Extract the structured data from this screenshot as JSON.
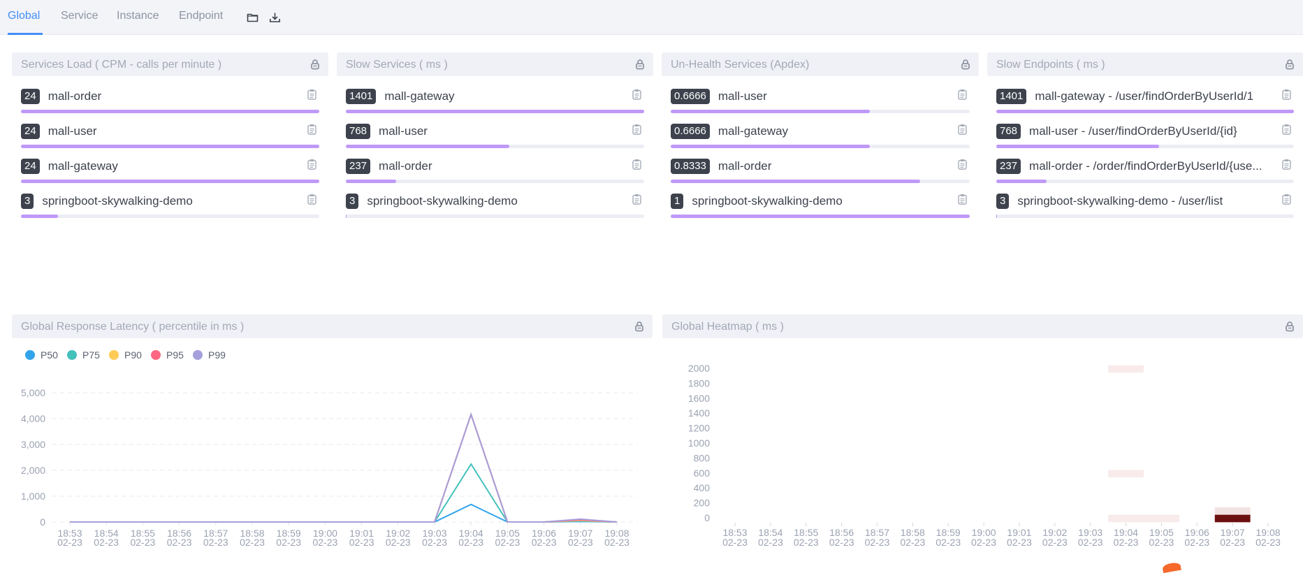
{
  "tabs": [
    {
      "label": "Global",
      "active": true
    },
    {
      "label": "Service",
      "active": false
    },
    {
      "label": "Instance",
      "active": false
    },
    {
      "label": "Endpoint",
      "active": false
    }
  ],
  "toolbar": {
    "icons": [
      "folder-icon",
      "download-icon"
    ]
  },
  "colors": {
    "accent": "#448ef7",
    "bar_fill": "#bf99f8",
    "bar_track": "#ecedf4",
    "badge": "#3d424d"
  },
  "panels": [
    {
      "title": "Services Load ( CPM - calls per minute )",
      "items": [
        {
          "value": "24",
          "label": "mall-order",
          "ratio": 1
        },
        {
          "value": "24",
          "label": "mall-user",
          "ratio": 1
        },
        {
          "value": "24",
          "label": "mall-gateway",
          "ratio": 1
        },
        {
          "value": "3",
          "label": "springboot-skywalking-demo",
          "ratio": 0.125
        }
      ]
    },
    {
      "title": "Slow Services ( ms )",
      "items": [
        {
          "value": "1401",
          "label": "mall-gateway",
          "ratio": 1
        },
        {
          "value": "768",
          "label": "mall-user",
          "ratio": 0.548
        },
        {
          "value": "237",
          "label": "mall-order",
          "ratio": 0.169
        },
        {
          "value": "3",
          "label": "springboot-skywalking-demo",
          "ratio": 0.002
        }
      ]
    },
    {
      "title": "Un-Health Services (Apdex)",
      "items": [
        {
          "value": "0.6666",
          "label": "mall-user",
          "ratio": 0.6666
        },
        {
          "value": "0.6666",
          "label": "mall-gateway",
          "ratio": 0.6666
        },
        {
          "value": "0.8333",
          "label": "mall-order",
          "ratio": 0.8333
        },
        {
          "value": "1",
          "label": "springboot-skywalking-demo",
          "ratio": 1
        }
      ]
    },
    {
      "title": "Slow Endpoints ( ms )",
      "items": [
        {
          "value": "1401",
          "label": "mall-gateway - /user/findOrderByUserId/1",
          "ratio": 1
        },
        {
          "value": "768",
          "label": "mall-user - /user/findOrderByUserId/{id}",
          "ratio": 0.548
        },
        {
          "value": "237",
          "label": "mall-order - /order/findOrderByUserId/{use...",
          "ratio": 0.169
        },
        {
          "value": "3",
          "label": "springboot-skywalking-demo - /user/list",
          "ratio": 0.002
        }
      ]
    }
  ],
  "chart_data": [
    {
      "type": "line",
      "title": "Global Response Latency ( percentile in ms )",
      "xlabel": "",
      "ylabel": "",
      "categories": [
        "18:53",
        "18:54",
        "18:55",
        "18:56",
        "18:57",
        "18:58",
        "18:59",
        "19:00",
        "19:01",
        "19:02",
        "19:03",
        "19:04",
        "19:05",
        "19:06",
        "19:07",
        "19:08"
      ],
      "category_date": "02-23",
      "ylim": [
        0,
        5000
      ],
      "yticks": [
        0,
        1000,
        2000,
        3000,
        4000,
        5000
      ],
      "ytick_labels": [
        "0",
        "1,000",
        "2,000",
        "3,000",
        "4,000",
        "5,000"
      ],
      "grid": true,
      "legend": "top-left",
      "series": [
        {
          "name": "P50",
          "color": "#32a4ec",
          "values": [
            0,
            0,
            0,
            0,
            0,
            0,
            0,
            0,
            0,
            0,
            0,
            680,
            0,
            0,
            20,
            0
          ]
        },
        {
          "name": "P75",
          "color": "#45c1bc",
          "values": [
            0,
            0,
            0,
            0,
            0,
            0,
            0,
            0,
            0,
            0,
            0,
            2240,
            0,
            0,
            40,
            0
          ]
        },
        {
          "name": "P90",
          "color": "#ffcb57",
          "values": [
            0,
            0,
            0,
            0,
            0,
            0,
            0,
            0,
            0,
            0,
            0,
            4160,
            0,
            0,
            60,
            0
          ]
        },
        {
          "name": "P95",
          "color": "#fd6782",
          "values": [
            0,
            0,
            0,
            0,
            0,
            0,
            0,
            0,
            0,
            0,
            0,
            4160,
            0,
            0,
            80,
            0
          ]
        },
        {
          "name": "P99",
          "color": "#a59fdc",
          "values": [
            0,
            0,
            0,
            0,
            0,
            0,
            0,
            0,
            0,
            0,
            0,
            4160,
            0,
            0,
            110,
            0
          ]
        }
      ]
    },
    {
      "type": "heatmap",
      "title": "Global Heatmap ( ms )",
      "xlabel": "",
      "ylabel": "",
      "categories": [
        "18:53",
        "18:54",
        "18:55",
        "18:56",
        "18:57",
        "18:58",
        "18:59",
        "19:00",
        "19:01",
        "19:02",
        "19:03",
        "19:04",
        "19:05",
        "19:06",
        "19:07",
        "19:08"
      ],
      "category_date": "02-23",
      "ylim": [
        0,
        2000
      ],
      "yticks": [
        0,
        200,
        400,
        600,
        800,
        1000,
        1200,
        1400,
        1600,
        1800,
        2000
      ],
      "ytick_labels": [
        "0",
        "200",
        "400",
        "600",
        "800",
        "1000",
        "1200",
        "1400",
        "1600",
        "1800",
        "2000"
      ],
      "bucket_ms": 100,
      "color_range": [
        "#fff5f5",
        "#6b1010"
      ],
      "cells": [
        {
          "x": "19:04",
          "y": 2000,
          "count": 1
        },
        {
          "x": "19:04",
          "y": 600,
          "count": 1
        },
        {
          "x": "19:04",
          "y": 0,
          "count": 1
        },
        {
          "x": "19:05",
          "y": 0,
          "count": 1
        },
        {
          "x": "19:07",
          "y": 100,
          "count": 2
        },
        {
          "x": "19:07",
          "y": 0,
          "count": 24
        }
      ]
    }
  ]
}
